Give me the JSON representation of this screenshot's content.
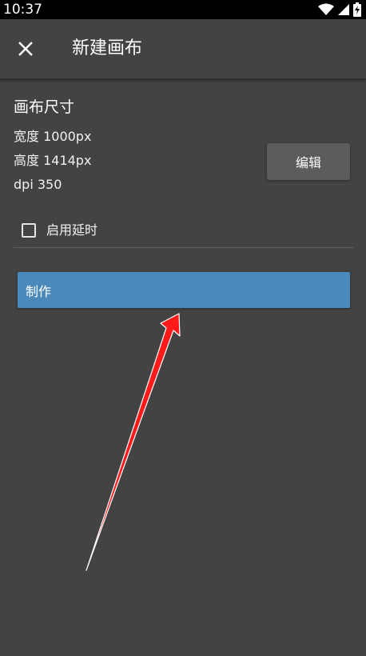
{
  "status_bar": {
    "time": "10:37",
    "icons": [
      "wifi-icon",
      "signal-icon",
      "battery-icon"
    ]
  },
  "app_bar": {
    "close_icon": "close-icon",
    "title": "新建画布"
  },
  "canvas_size": {
    "section_title": "画布尺寸",
    "width_line": "宽度 1000px",
    "height_line": "高度 1414px",
    "dpi_line": "dpi 350",
    "edit_label": "编辑"
  },
  "options": {
    "enable_delay_label": "启用延时",
    "enable_delay_checked": false
  },
  "actions": {
    "make_label": "制作"
  },
  "colors": {
    "background": "#434343",
    "status_bar": "#000000",
    "primary_button": "#4a89b9",
    "secondary_button": "#5c5c5c",
    "annotation_arrow": "#ff0000"
  }
}
